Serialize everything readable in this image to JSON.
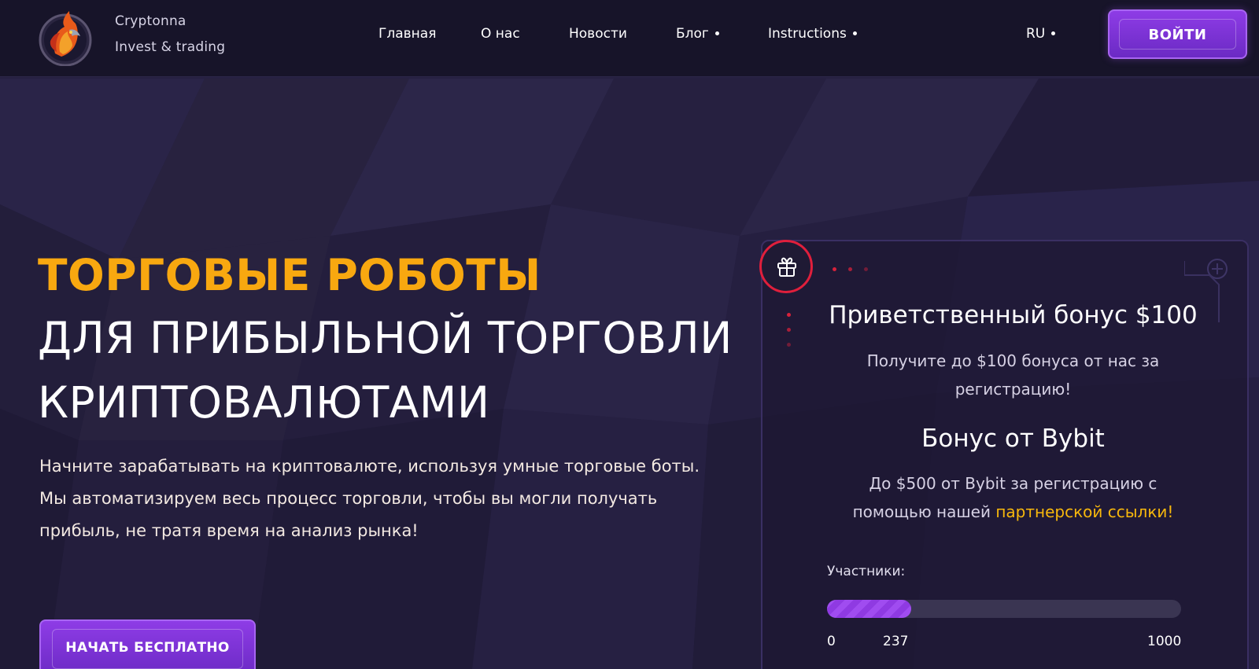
{
  "header": {
    "brand_name": "Cryptonna",
    "brand_tagline": "Invest & trading",
    "nav": [
      {
        "label": "Главная",
        "has_dropdown": false
      },
      {
        "label": "О нас",
        "has_dropdown": false
      },
      {
        "label": "Новости",
        "has_dropdown": false
      },
      {
        "label": "Блог",
        "has_dropdown": true
      },
      {
        "label": "Instructions",
        "has_dropdown": true
      }
    ],
    "language": "RU",
    "login_label": "ВОЙТИ"
  },
  "hero": {
    "title_accent": "ТОРГОВЫЕ РОБОТЫ",
    "title_line_2": "ДЛЯ ПРИБЫЛЬНОЙ ТОРГОВЛИ",
    "title_line_3": "КРИПТОВАЛЮТАМИ",
    "description": "Начните зарабатывать на криптовалюте, используя умные торговые боты. Мы автоматизируем весь процесс торговли, чтобы вы могли получать прибыль, не тратя время на анализ рынка!",
    "cta_label": "НАЧАТЬ БЕСПЛАТНО"
  },
  "bonus_card": {
    "icon": "gift-icon",
    "welcome_title": "Приветственный бонус $100",
    "welcome_text": "Получите до $100 бонуса от нас за регистрацию!",
    "bybit_title": "Бонус от Bybit",
    "bybit_text_prefix": "До $500 от Bybit за регистрацию с помощью нашей ",
    "bybit_link_text": "партнерской ссылки!",
    "participants_label": "Участники:",
    "progress": {
      "min": 0,
      "current": 237,
      "max": 1000
    },
    "scale_min_label": "0",
    "scale_current_label": "237",
    "scale_max_label": "1000"
  },
  "colors": {
    "accent_orange": "#f8a810",
    "button_purple": "#7c33d6",
    "link_yellow": "#f8b80c",
    "gift_ring_red": "#e01f3c",
    "background": "#221d3a"
  }
}
